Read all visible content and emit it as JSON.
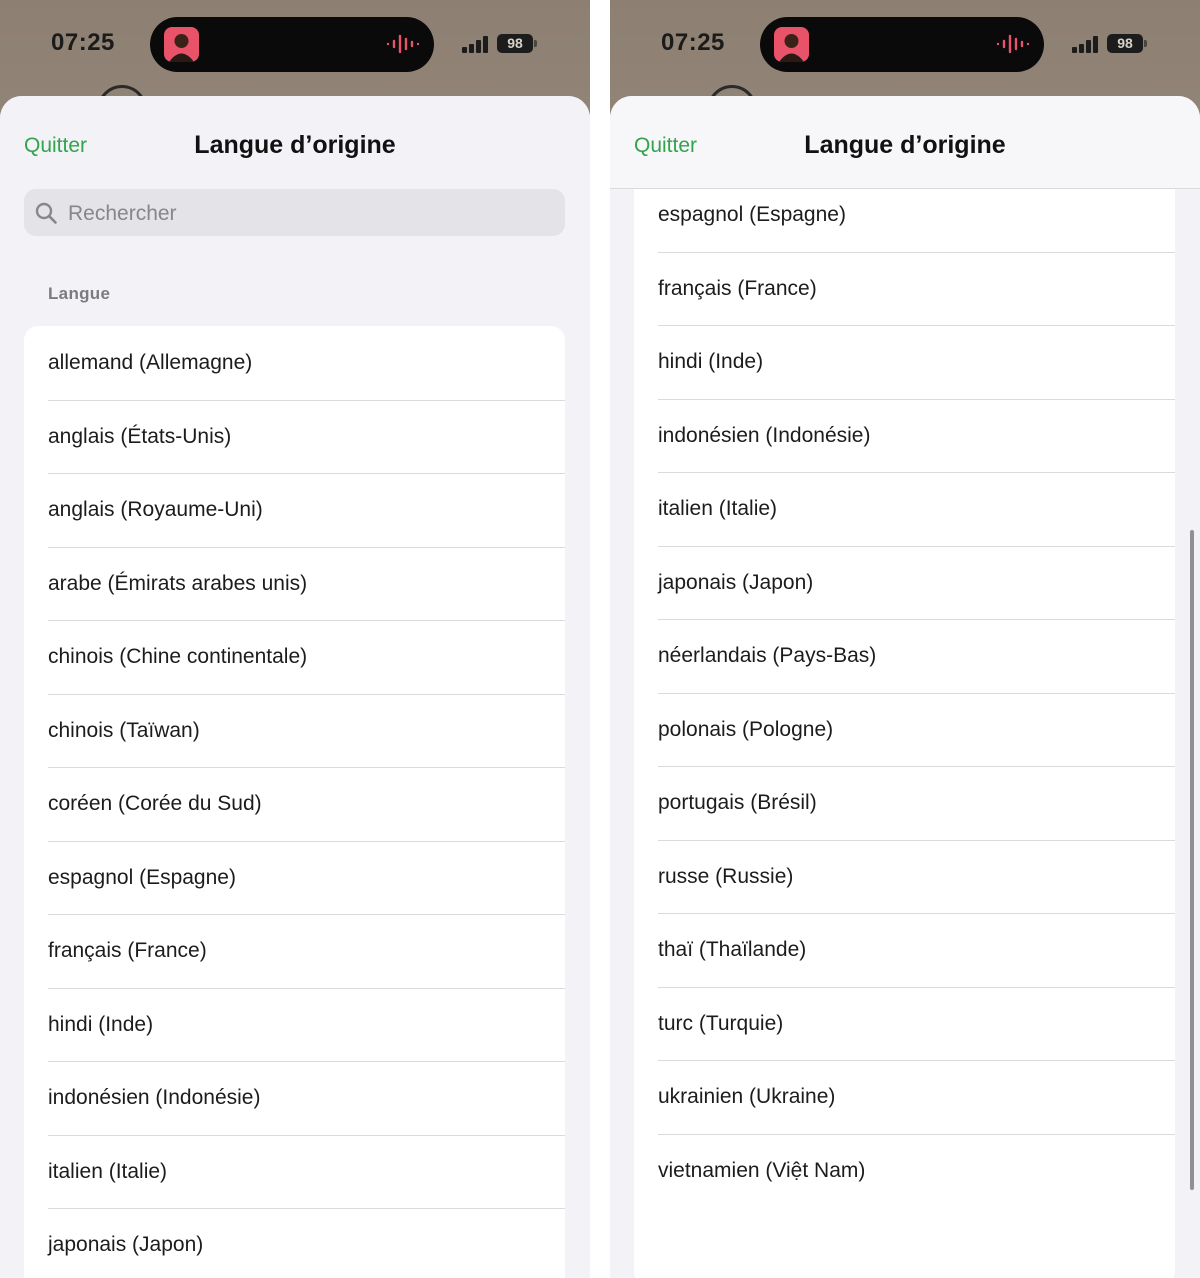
{
  "status": {
    "time": "07:25",
    "battery": "98"
  },
  "header": {
    "quit_label": "Quitter",
    "title": "Langue d’origine"
  },
  "search": {
    "placeholder": "Rechercher"
  },
  "section": {
    "label": "Langue"
  },
  "left_languages": [
    "allemand (Allemagne)",
    "anglais (États-Unis)",
    "anglais (Royaume-Uni)",
    "arabe (Émirats arabes unis)",
    "chinois (Chine continentale)",
    "chinois (Taïwan)",
    "coréen (Corée du Sud)",
    "espagnol (Espagne)",
    "français (France)",
    "hindi (Inde)",
    "indonésien (Indonésie)",
    "italien (Italie)",
    "japonais (Japon)"
  ],
  "right_languages": [
    "espagnol (Espagne)",
    "français (France)",
    "hindi (Inde)",
    "indonésien (Indonésie)",
    "italien (Italie)",
    "japonais (Japon)",
    "néerlandais (Pays-Bas)",
    "polonais (Pologne)",
    "portugais (Brésil)",
    "russe (Russie)",
    "thaï (Thaïlande)",
    "turc (Turquie)",
    "ukrainien (Ukraine)",
    "vietnamien (Việt Nam)"
  ],
  "colors": {
    "accent": "#33a34e",
    "sheet_bg": "#f2f2f7",
    "island_wave": "#e9536a"
  },
  "icons": {
    "search": "magnifying-glass",
    "island_activity": "waveform",
    "signal": "cellular-bars"
  }
}
